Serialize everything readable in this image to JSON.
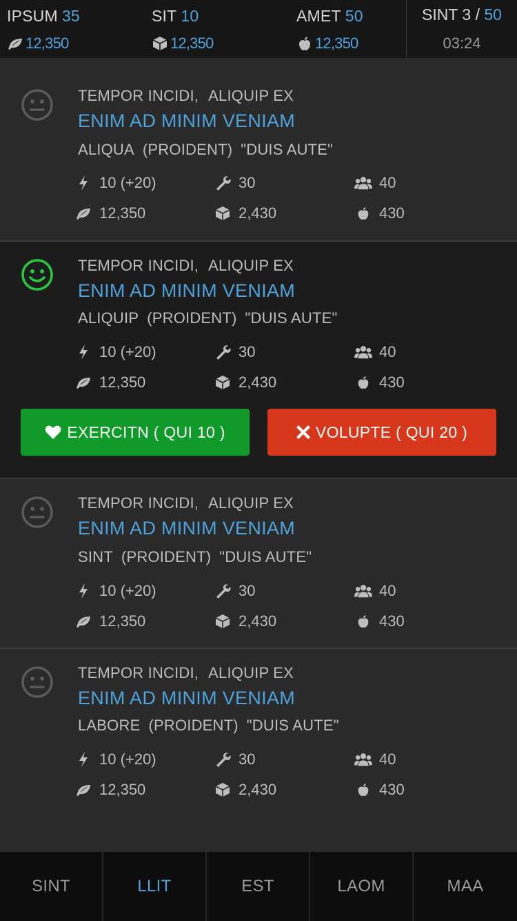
{
  "colors": {
    "accent": "#4ea3dc",
    "happy": "#27c93f",
    "green_button": "#0f9a2a",
    "red_button": "#d7371b"
  },
  "topbar": {
    "stats": [
      {
        "label": "IPSUM",
        "num": "35",
        "icon": "leaf-icon",
        "value": "12,350"
      },
      {
        "label": "SIT",
        "num": "10",
        "icon": "cube-icon",
        "value": "12,350"
      },
      {
        "label": "AMET",
        "num": "50",
        "icon": "apple-icon",
        "value": "12,350"
      }
    ],
    "sint": {
      "label": "SINT 3 / ",
      "num": "50",
      "timer": "03:24"
    }
  },
  "cards": [
    {
      "mood": "neutral",
      "meta_a": "TEMPOR INCIDI,",
      "meta_b": "ALIQUIP EX",
      "title": "ENIM AD MINIM VENIAM",
      "sub_a": "ALIQUA",
      "sub_b": "(PROIDENT)",
      "sub_c": "\"DUIS AUTE\"",
      "energy": "10 (+20)",
      "tools": "30",
      "people": "40",
      "leaf": "12,350",
      "cube": "2,430",
      "apple": "430"
    },
    {
      "mood": "happy",
      "meta_a": "TEMPOR INCIDI,",
      "meta_b": "ALIQUIP EX",
      "title": "ENIM AD MINIM VENIAM",
      "sub_a": "ALIQUIP",
      "sub_b": "(PROIDENT)",
      "sub_c": "\"DUIS AUTE\"",
      "energy": "10 (+20)",
      "tools": "30",
      "people": "40",
      "leaf": "12,350",
      "cube": "2,430",
      "apple": "430"
    },
    {
      "mood": "neutral",
      "meta_a": "TEMPOR INCIDI,",
      "meta_b": "ALIQUIP EX",
      "title": "ENIM AD MINIM VENIAM",
      "sub_a": "SINT",
      "sub_b": "(PROIDENT)",
      "sub_c": "\"DUIS AUTE\"",
      "energy": "10 (+20)",
      "tools": "30",
      "people": "40",
      "leaf": "12,350",
      "cube": "2,430",
      "apple": "430"
    },
    {
      "mood": "neutral",
      "meta_a": "TEMPOR INCIDI,",
      "meta_b": "ALIQUIP EX",
      "title": "ENIM AD MINIM VENIAM",
      "sub_a": "LABORE",
      "sub_b": "(PROIDENT)",
      "sub_c": "\"DUIS AUTE\"",
      "energy": "10 (+20)",
      "tools": "30",
      "people": "40",
      "leaf": "12,350",
      "cube": "2,430",
      "apple": "430"
    }
  ],
  "actions": {
    "accept": {
      "icon": "heart-icon",
      "label": "EXERCITN",
      "detail": "( QUI 10 )"
    },
    "reject": {
      "icon": "x-icon",
      "label": "VOLUPTE",
      "detail": "( QUI 20 )"
    }
  },
  "tabs": [
    {
      "label": "SINT",
      "active": false
    },
    {
      "label": "LLIT",
      "active": true
    },
    {
      "label": "EST",
      "active": false
    },
    {
      "label": "LAOM",
      "active": false
    },
    {
      "label": "MAA",
      "active": false
    }
  ]
}
